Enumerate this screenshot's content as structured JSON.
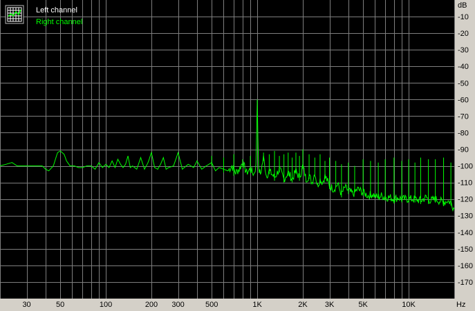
{
  "chart_data": {
    "type": "line",
    "title": "",
    "xlabel": "",
    "ylabel": "",
    "x_scale": "log",
    "xlim": [
      20,
      20000
    ],
    "ylim": [
      -180,
      0
    ],
    "grid": true,
    "legend_placement": "top-left",
    "x_unit_label": "Hz",
    "y_unit_label": "dB",
    "x_tick_labels": [
      {
        "value": 30,
        "label": "30"
      },
      {
        "value": 50,
        "label": "50"
      },
      {
        "value": 100,
        "label": "100"
      },
      {
        "value": 200,
        "label": "200"
      },
      {
        "value": 300,
        "label": "300"
      },
      {
        "value": 500,
        "label": "500"
      },
      {
        "value": 1000,
        "label": "1K"
      },
      {
        "value": 2000,
        "label": "2K"
      },
      {
        "value": 3000,
        "label": "3K"
      },
      {
        "value": 5000,
        "label": "5K"
      },
      {
        "value": 10000,
        "label": "10K"
      }
    ],
    "y_tick_labels": [
      {
        "value": -10,
        "label": "-10"
      },
      {
        "value": -20,
        "label": "-20"
      },
      {
        "value": -30,
        "label": "-30"
      },
      {
        "value": -40,
        "label": "-40"
      },
      {
        "value": -50,
        "label": "-50"
      },
      {
        "value": -60,
        "label": "-60"
      },
      {
        "value": -70,
        "label": "-70"
      },
      {
        "value": -80,
        "label": "-80"
      },
      {
        "value": -90,
        "label": "-90"
      },
      {
        "value": -100,
        "label": "-100"
      },
      {
        "value": -110,
        "label": "-110"
      },
      {
        "value": -120,
        "label": "-120"
      },
      {
        "value": -130,
        "label": "-130"
      },
      {
        "value": -140,
        "label": "-140"
      },
      {
        "value": -150,
        "label": "-150"
      },
      {
        "value": -160,
        "label": "-160"
      },
      {
        "value": -170,
        "label": "-170"
      }
    ],
    "series": [
      {
        "name": "Left channel",
        "color": "#ffffff",
        "visible_trace": false,
        "x": [],
        "y": []
      },
      {
        "name": "Right channel",
        "color": "#00ff00",
        "x": [
          20,
          22,
          24,
          26,
          30,
          35,
          38,
          40,
          42,
          45,
          48,
          50,
          53,
          55,
          58,
          62,
          66,
          70,
          75,
          80,
          85,
          90,
          95,
          100,
          105,
          110,
          115,
          120,
          125,
          130,
          135,
          140,
          145,
          150,
          160,
          170,
          180,
          190,
          200,
          210,
          220,
          230,
          240,
          250,
          260,
          280,
          300,
          320,
          350,
          380,
          400,
          430,
          460,
          500,
          530,
          560,
          600,
          640,
          680,
          720,
          760,
          800,
          850,
          900,
          950,
          980,
          1000,
          1020,
          1050,
          1100,
          1150,
          1200,
          1300,
          1400,
          1500,
          1600,
          1700,
          1800,
          1900,
          2000,
          2100,
          2200,
          2300,
          2400,
          2500,
          2600,
          2700,
          2800,
          3000,
          3200,
          3400,
          3600,
          3800,
          4000,
          4300,
          4600,
          5000,
          5400,
          5800,
          6200,
          6600,
          7000,
          7500,
          8000,
          8500,
          9000,
          9500,
          10000,
          11000,
          12000,
          13000,
          14000,
          15000,
          16000,
          17000,
          18000,
          19000,
          20000
        ],
        "y": [
          -100,
          -99,
          -98,
          -100,
          -100,
          -100,
          -100,
          -102,
          -103,
          -100,
          -92,
          -91,
          -93,
          -97,
          -100,
          -100,
          -101,
          -101,
          -100,
          -100,
          -102,
          -98,
          -101,
          -99,
          -101,
          -97,
          -101,
          -96,
          -99,
          -101,
          -99,
          -94,
          -101,
          -100,
          -102,
          -95,
          -102,
          -98,
          -92,
          -101,
          -102,
          -99,
          -95,
          -102,
          -101,
          -100,
          -92,
          -102,
          -99,
          -101,
          -97,
          -102,
          -100,
          -98,
          -103,
          -101,
          -102,
          -103,
          -100,
          -104,
          -102,
          -98,
          -104,
          -102,
          -105,
          -100,
          -60,
          -102,
          -105,
          -95,
          -106,
          -103,
          -107,
          -102,
          -108,
          -104,
          -108,
          -103,
          -107,
          -100,
          -108,
          -106,
          -110,
          -104,
          -112,
          -108,
          -110,
          -106,
          -112,
          -114,
          -111,
          -117,
          -113,
          -115,
          -117,
          -114,
          -116,
          -118,
          -117,
          -119,
          -118,
          -119,
          -119,
          -120,
          -119,
          -120,
          -120,
          -120,
          -120,
          -121,
          -119,
          -121,
          -120,
          -121,
          -122,
          -121,
          -122,
          -126
        ]
      }
    ],
    "harmonic_spikes": {
      "series": "Right channel",
      "x": [
        500,
        600,
        700,
        800,
        900,
        1000,
        1100,
        1200,
        1300,
        1400,
        1500,
        1600,
        1700,
        1800,
        1900,
        2000,
        2200,
        2400,
        2600,
        2800,
        3000,
        3300,
        3600,
        4000,
        4400,
        5000,
        5600,
        6300,
        7000,
        8000,
        9000,
        10000,
        11000,
        12000,
        13500,
        15000,
        17000,
        19000
      ],
      "y": [
        -94,
        -95,
        -93,
        -96,
        -94,
        -60,
        -92,
        -93,
        -91,
        -94,
        -93,
        -92,
        -95,
        -92,
        -94,
        -90,
        -93,
        -95,
        -93,
        -97,
        -95,
        -97,
        -99,
        -98,
        -100,
        -96,
        -97,
        -98,
        -96,
        -95,
        -97,
        -96,
        -98,
        -95,
        -96,
        -96,
        -95,
        -98
      ]
    }
  }
}
